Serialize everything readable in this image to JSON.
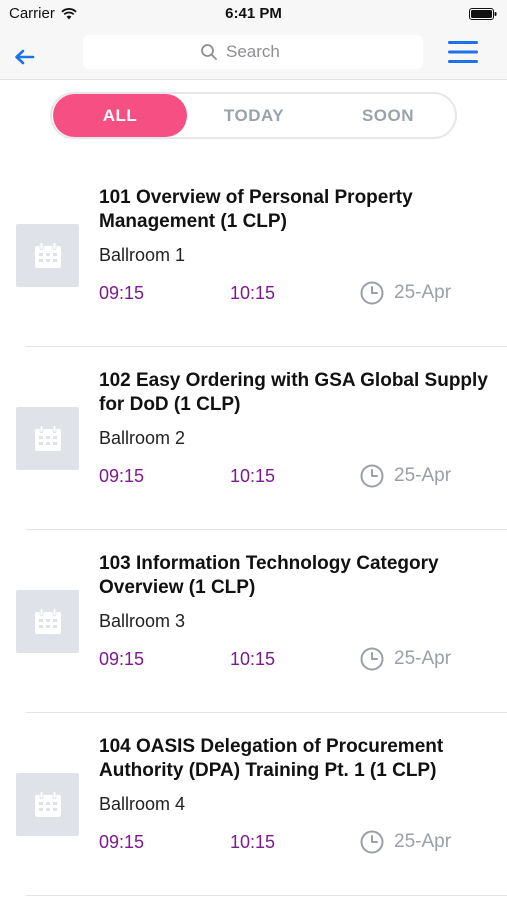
{
  "status_bar": {
    "carrier": "Carrier",
    "time": "6:41 PM"
  },
  "nav": {
    "search_placeholder": "Search"
  },
  "segments": [
    {
      "label": "ALL",
      "active": true
    },
    {
      "label": "TODAY",
      "active": false
    },
    {
      "label": "SOON",
      "active": false
    }
  ],
  "colors": {
    "accent_pink": "#f64f83",
    "time_purple": "#7d1a8e",
    "nav_blue": "#1a73e8",
    "thumb_gray": "#dfe3e9"
  },
  "icons": [
    "wifi-icon",
    "battery-icon",
    "back-arrow-icon",
    "search-icon",
    "hamburger-menu-icon",
    "calendar-icon",
    "clock-icon"
  ],
  "sessions": [
    {
      "title": "101 Overview of Personal Property Management (1 CLP)",
      "room": "Ballroom 1",
      "start": "09:15",
      "end": "10:15",
      "date": "25-Apr"
    },
    {
      "title": "102 Easy Ordering with GSA Global Supply for DoD (1 CLP)",
      "room": "Ballroom 2",
      "start": "09:15",
      "end": "10:15",
      "date": "25-Apr"
    },
    {
      "title": "103 Information Technology Category Overview (1 CLP)",
      "room": "Ballroom 3",
      "start": "09:15",
      "end": "10:15",
      "date": "25-Apr"
    },
    {
      "title": "104 OASIS Delegation of Procurement Authority (DPA) Training Pt. 1 (1 CLP)",
      "room": "Ballroom 4",
      "start": "09:15",
      "end": "10:15",
      "date": "25-Apr"
    }
  ]
}
